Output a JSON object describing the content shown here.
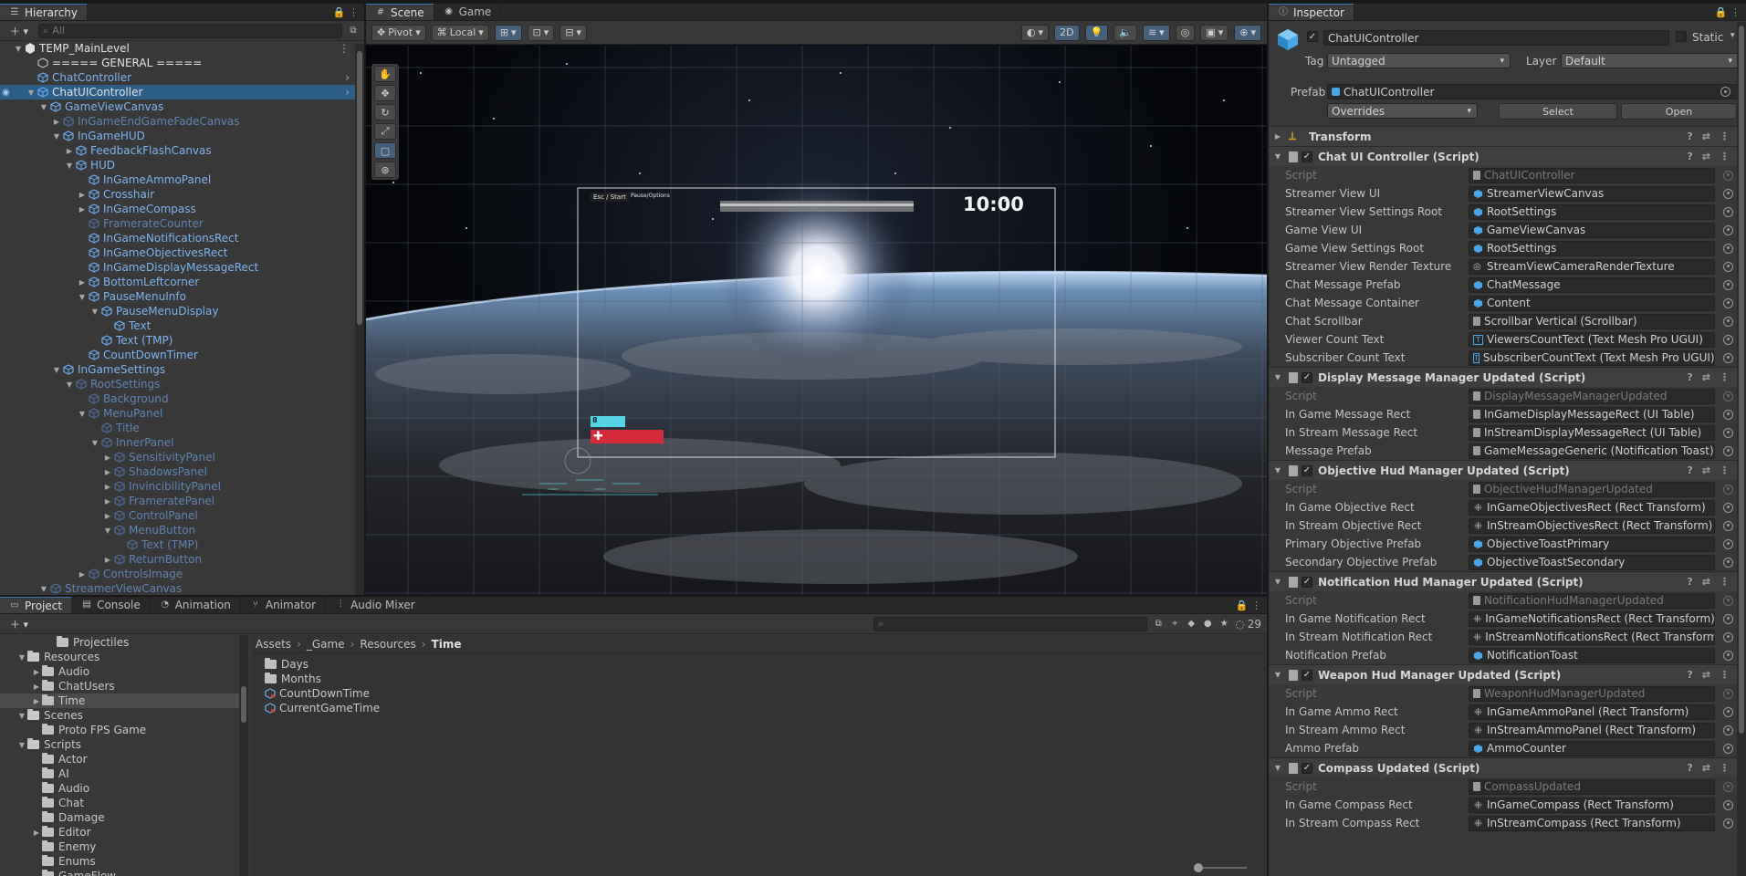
{
  "hierarchy": {
    "tab": "Hierarchy",
    "search_placeholder": "All",
    "items": [
      {
        "label": "TEMP_MainLevel",
        "depth": 0,
        "arrow": "open",
        "style": "white",
        "icon": "unity",
        "menu": "⋮"
      },
      {
        "label": "===== GENERAL =====",
        "depth": 1,
        "arrow": "",
        "style": "white",
        "icon": "cube"
      },
      {
        "label": "ChatController",
        "depth": 1,
        "arrow": "",
        "style": "blue",
        "icon": "prefab",
        "right": "›"
      },
      {
        "label": "ChatUIController",
        "depth": 1,
        "arrow": "open",
        "style": "white",
        "icon": "prefab",
        "selected": true,
        "right": "›"
      },
      {
        "label": "GameViewCanvas",
        "depth": 2,
        "arrow": "open",
        "style": "blue",
        "icon": "prefab"
      },
      {
        "label": "InGameEndGameFadeCanvas",
        "depth": 3,
        "arrow": "closed",
        "style": "dim",
        "icon": "prefab"
      },
      {
        "label": "InGameHUD",
        "depth": 3,
        "arrow": "open",
        "style": "blue",
        "icon": "prefab"
      },
      {
        "label": "FeedbackFlashCanvas",
        "depth": 4,
        "arrow": "closed",
        "style": "blue",
        "icon": "prefab"
      },
      {
        "label": "HUD",
        "depth": 4,
        "arrow": "open",
        "style": "blue",
        "icon": "prefab"
      },
      {
        "label": "InGameAmmoPanel",
        "depth": 5,
        "arrow": "",
        "style": "blue",
        "icon": "prefab"
      },
      {
        "label": "Crosshair",
        "depth": 5,
        "arrow": "closed",
        "style": "blue",
        "icon": "prefab"
      },
      {
        "label": "InGameCompass",
        "depth": 5,
        "arrow": "closed",
        "style": "blue",
        "icon": "prefab"
      },
      {
        "label": "FramerateCounter",
        "depth": 5,
        "arrow": "",
        "style": "dim",
        "icon": "prefab"
      },
      {
        "label": "InGameNotificationsRect",
        "depth": 5,
        "arrow": "",
        "style": "blue",
        "icon": "prefab"
      },
      {
        "label": "InGameObjectivesRect",
        "depth": 5,
        "arrow": "",
        "style": "blue",
        "icon": "prefab"
      },
      {
        "label": "InGameDisplayMessageRect",
        "depth": 5,
        "arrow": "",
        "style": "blue",
        "icon": "prefab"
      },
      {
        "label": "BottomLeftcorner",
        "depth": 5,
        "arrow": "closed",
        "style": "blue",
        "icon": "prefab"
      },
      {
        "label": "PauseMenuInfo",
        "depth": 5,
        "arrow": "open",
        "style": "blue",
        "icon": "prefab"
      },
      {
        "label": "PauseMenuDisplay",
        "depth": 6,
        "arrow": "open",
        "style": "blue",
        "icon": "prefab"
      },
      {
        "label": "Text",
        "depth": 7,
        "arrow": "",
        "style": "blue",
        "icon": "prefab"
      },
      {
        "label": "Text (TMP)",
        "depth": 6,
        "arrow": "",
        "style": "blue",
        "icon": "prefab"
      },
      {
        "label": "CountDownTimer",
        "depth": 5,
        "arrow": "",
        "style": "blue",
        "icon": "prefab"
      },
      {
        "label": "InGameSettings",
        "depth": 3,
        "arrow": "open",
        "style": "blue",
        "icon": "prefab"
      },
      {
        "label": "RootSettings",
        "depth": 4,
        "arrow": "open",
        "style": "dim",
        "icon": "prefab"
      },
      {
        "label": "Background",
        "depth": 5,
        "arrow": "",
        "style": "dim",
        "icon": "prefab"
      },
      {
        "label": "MenuPanel",
        "depth": 5,
        "arrow": "open",
        "style": "dim",
        "icon": "prefab"
      },
      {
        "label": "Title",
        "depth": 6,
        "arrow": "",
        "style": "dim",
        "icon": "prefab"
      },
      {
        "label": "InnerPanel",
        "depth": 6,
        "arrow": "open",
        "style": "dim",
        "icon": "prefab"
      },
      {
        "label": "SensitivityPanel",
        "depth": 7,
        "arrow": "closed",
        "style": "dim",
        "icon": "prefab"
      },
      {
        "label": "ShadowsPanel",
        "depth": 7,
        "arrow": "closed",
        "style": "dim",
        "icon": "prefab"
      },
      {
        "label": "InvincibilityPanel",
        "depth": 7,
        "arrow": "closed",
        "style": "dim",
        "icon": "prefab"
      },
      {
        "label": "FrameratePanel",
        "depth": 7,
        "arrow": "closed",
        "style": "dim",
        "icon": "prefab"
      },
      {
        "label": "ControlPanel",
        "depth": 7,
        "arrow": "closed",
        "style": "dim",
        "icon": "prefab"
      },
      {
        "label": "MenuButton",
        "depth": 7,
        "arrow": "open",
        "style": "dim",
        "icon": "prefab"
      },
      {
        "label": "Text (TMP)",
        "depth": 8,
        "arrow": "",
        "style": "dim",
        "icon": "prefab"
      },
      {
        "label": "ReturnButton",
        "depth": 7,
        "arrow": "closed",
        "style": "dim",
        "icon": "prefab"
      },
      {
        "label": "ControlsImage",
        "depth": 5,
        "arrow": "closed",
        "style": "dim",
        "icon": "prefab"
      },
      {
        "label": "StreamerViewCanvas",
        "depth": 2,
        "arrow": "open",
        "style": "dim",
        "icon": "prefab"
      }
    ]
  },
  "scene": {
    "tabs": [
      "Scene",
      "Game"
    ],
    "pivot": "Pivot",
    "space": "Local",
    "mode2d": "2D",
    "hud_buttons": "Esc / Start",
    "hud_pause": "Pause/Options",
    "timer": "10:00",
    "ammo": "8"
  },
  "inspector": {
    "tab": "Inspector",
    "object_name": "ChatUIController",
    "static_label": "Static",
    "tag_label": "Tag",
    "tag_value": "Untagged",
    "layer_label": "Layer",
    "layer_value": "Default",
    "prefab_label": "Prefab",
    "prefab_value": "ChatUIController",
    "overrides": "Overrides",
    "select": "Select",
    "open": "Open",
    "transform": "Transform",
    "components": [
      {
        "title": "Chat UI Controller (Script)",
        "rows": [
          {
            "label": "Script",
            "value": "ChatUIController",
            "dim": true,
            "icon": "script"
          },
          {
            "label": "Streamer View UI",
            "value": "StreamerViewCanvas",
            "icon": "prefab"
          },
          {
            "label": "Streamer View Settings Root",
            "value": "RootSettings",
            "icon": "prefab"
          },
          {
            "label": "Game View UI",
            "value": "GameViewCanvas",
            "icon": "prefab"
          },
          {
            "label": "Game View Settings Root",
            "value": "RootSettings",
            "icon": "prefab"
          },
          {
            "label": "Streamer View Render Texture",
            "value": "StreamViewCameraRenderTexture",
            "icon": "texture"
          },
          {
            "label": "Chat Message Prefab",
            "value": "ChatMessage",
            "icon": "prefab"
          },
          {
            "label": "Chat Message Container",
            "value": "Content",
            "icon": "prefab"
          },
          {
            "label": "Chat Scrollbar",
            "value": "Scrollbar Vertical (Scrollbar)",
            "icon": "script"
          },
          {
            "label": "Viewer Count Text",
            "value": "ViewersCountText (Text Mesh Pro UGUI)",
            "icon": "tmp"
          },
          {
            "label": "Subscriber Count Text",
            "value": "SubscriberCountText (Text Mesh Pro UGUI)",
            "icon": "tmp"
          }
        ]
      },
      {
        "title": "Display Message Manager Updated (Script)",
        "rows": [
          {
            "label": "Script",
            "value": "DisplayMessageManagerUpdated",
            "dim": true,
            "icon": "script"
          },
          {
            "label": "In Game Message Rect",
            "value": "InGameDisplayMessageRect (UI Table)",
            "icon": "script"
          },
          {
            "label": "In Stream Message Rect",
            "value": "InStreamDisplayMessageRect (UI Table)",
            "icon": "script"
          },
          {
            "label": "Message Prefab",
            "value": "GameMessageGeneric (Notification Toast)",
            "icon": "script"
          }
        ]
      },
      {
        "title": "Objective Hud Manager Updated (Script)",
        "rows": [
          {
            "label": "Script",
            "value": "ObjectiveHudManagerUpdated",
            "dim": true,
            "icon": "script"
          },
          {
            "label": "In Game Objective Rect",
            "value": "InGameObjectivesRect (Rect Transform)",
            "icon": "rect"
          },
          {
            "label": "In Stream Objective Rect",
            "value": "InStreamObjectivesRect (Rect Transform)",
            "icon": "rect"
          },
          {
            "label": "Primary Objective Prefab",
            "value": "ObjectiveToastPrimary",
            "icon": "prefab"
          },
          {
            "label": "Secondary Objective Prefab",
            "value": "ObjectiveToastSecondary",
            "icon": "prefab"
          }
        ]
      },
      {
        "title": "Notification Hud Manager Updated (Script)",
        "rows": [
          {
            "label": "Script",
            "value": "NotificationHudManagerUpdated",
            "dim": true,
            "icon": "script"
          },
          {
            "label": "In Game Notification Rect",
            "value": "InGameNotificationsRect (Rect Transform)",
            "icon": "rect"
          },
          {
            "label": "In Stream Notification Rect",
            "value": "InStreamNotificationsRect (Rect Transform)",
            "icon": "rect"
          },
          {
            "label": "Notification Prefab",
            "value": "NotificationToast",
            "icon": "prefab"
          }
        ]
      },
      {
        "title": "Weapon Hud Manager Updated (Script)",
        "rows": [
          {
            "label": "Script",
            "value": "WeaponHudManagerUpdated",
            "dim": true,
            "icon": "script"
          },
          {
            "label": "In Game Ammo Rect",
            "value": "InGameAmmoPanel (Rect Transform)",
            "icon": "rect"
          },
          {
            "label": "In Stream Ammo Rect",
            "value": "InStreamAmmoPanel (Rect Transform)",
            "icon": "rect"
          },
          {
            "label": "Ammo Prefab",
            "value": "AmmoCounter",
            "icon": "prefab"
          }
        ]
      },
      {
        "title": "Compass Updated (Script)",
        "rows": [
          {
            "label": "Script",
            "value": "CompassUpdated",
            "dim": true,
            "icon": "script"
          },
          {
            "label": "In Game Compass Rect",
            "value": "InGameCompass (Rect Transform)",
            "icon": "rect"
          },
          {
            "label": "In Stream Compass Rect",
            "value": "InStreamCompass (Rect Transform)",
            "icon": "rect"
          }
        ]
      }
    ]
  },
  "project": {
    "tabs": [
      "Project",
      "Console",
      "Animation",
      "Animator",
      "Audio Mixer"
    ],
    "count": "29",
    "breadcrumb": [
      "Assets",
      "_Game",
      "Resources",
      "Time"
    ],
    "tree": [
      {
        "label": "Projectiles",
        "depth": 3,
        "arrow": ""
      },
      {
        "label": "Resources",
        "depth": 1,
        "arrow": "open"
      },
      {
        "label": "Audio",
        "depth": 2,
        "arrow": "closed"
      },
      {
        "label": "ChatUsers",
        "depth": 2,
        "arrow": "closed"
      },
      {
        "label": "Time",
        "depth": 2,
        "arrow": "closed",
        "selected": true
      },
      {
        "label": "Scenes",
        "depth": 1,
        "arrow": "open"
      },
      {
        "label": "Proto FPS Game",
        "depth": 2,
        "arrow": ""
      },
      {
        "label": "Scripts",
        "depth": 1,
        "arrow": "open"
      },
      {
        "label": "Actor",
        "depth": 2,
        "arrow": ""
      },
      {
        "label": "AI",
        "depth": 2,
        "arrow": ""
      },
      {
        "label": "Audio",
        "depth": 2,
        "arrow": ""
      },
      {
        "label": "Chat",
        "depth": 2,
        "arrow": ""
      },
      {
        "label": "Damage",
        "depth": 2,
        "arrow": ""
      },
      {
        "label": "Editor",
        "depth": 2,
        "arrow": "closed"
      },
      {
        "label": "Enemy",
        "depth": 2,
        "arrow": ""
      },
      {
        "label": "Enums",
        "depth": 2,
        "arrow": ""
      },
      {
        "label": "GameFlow",
        "depth": 2,
        "arrow": ""
      }
    ],
    "files": [
      {
        "label": "Days",
        "type": "folder"
      },
      {
        "label": "Months",
        "type": "folder"
      },
      {
        "label": "CountDownTime",
        "type": "asset"
      },
      {
        "label": "CurrentGameTime",
        "type": "asset"
      }
    ]
  },
  "colors": {
    "selection": "#2c5d87",
    "accent": "#3a79bb",
    "prefab_blue": "#7fb4f0"
  }
}
